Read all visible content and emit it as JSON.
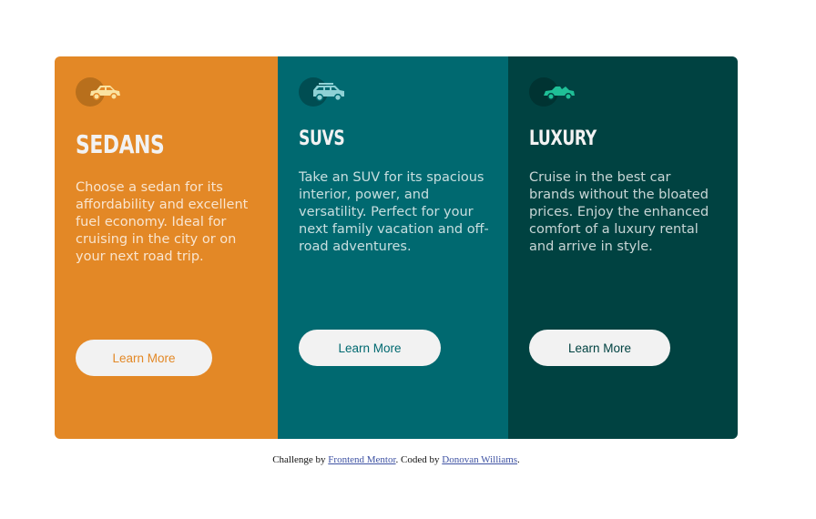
{
  "cards": [
    {
      "icon": "sedan-car-icon",
      "title": "SEDANS",
      "description": "Choose a sedan for its affordability and excellent fuel economy. Ideal for cruising in the city or on your next road trip.",
      "button_label": "Learn More",
      "bg_color": "#e38826"
    },
    {
      "icon": "suv-car-icon",
      "title": "SUVS",
      "description": "Take an SUV for its spacious interior, power, and versatility. Perfect for your next family vacation and off-road adventures.",
      "button_label": "Learn More",
      "bg_color": "#006970"
    },
    {
      "icon": "luxury-car-icon",
      "title": "LUXURY",
      "description": "Cruise in the best car brands without the bloated prices. Enjoy the enhanced comfort of a luxury rental and arrive in style.",
      "button_label": "Learn More",
      "bg_color": "#004241"
    }
  ],
  "attribution": {
    "prefix": "Challenge by ",
    "link1": "Frontend Mentor",
    "middle": ". Coded by ",
    "link2": "Donovan Williams",
    "suffix": "."
  },
  "colors": {
    "orange": "#e38826",
    "teal": "#006970",
    "dark_teal": "#004241",
    "light": "#f2f2f2"
  }
}
